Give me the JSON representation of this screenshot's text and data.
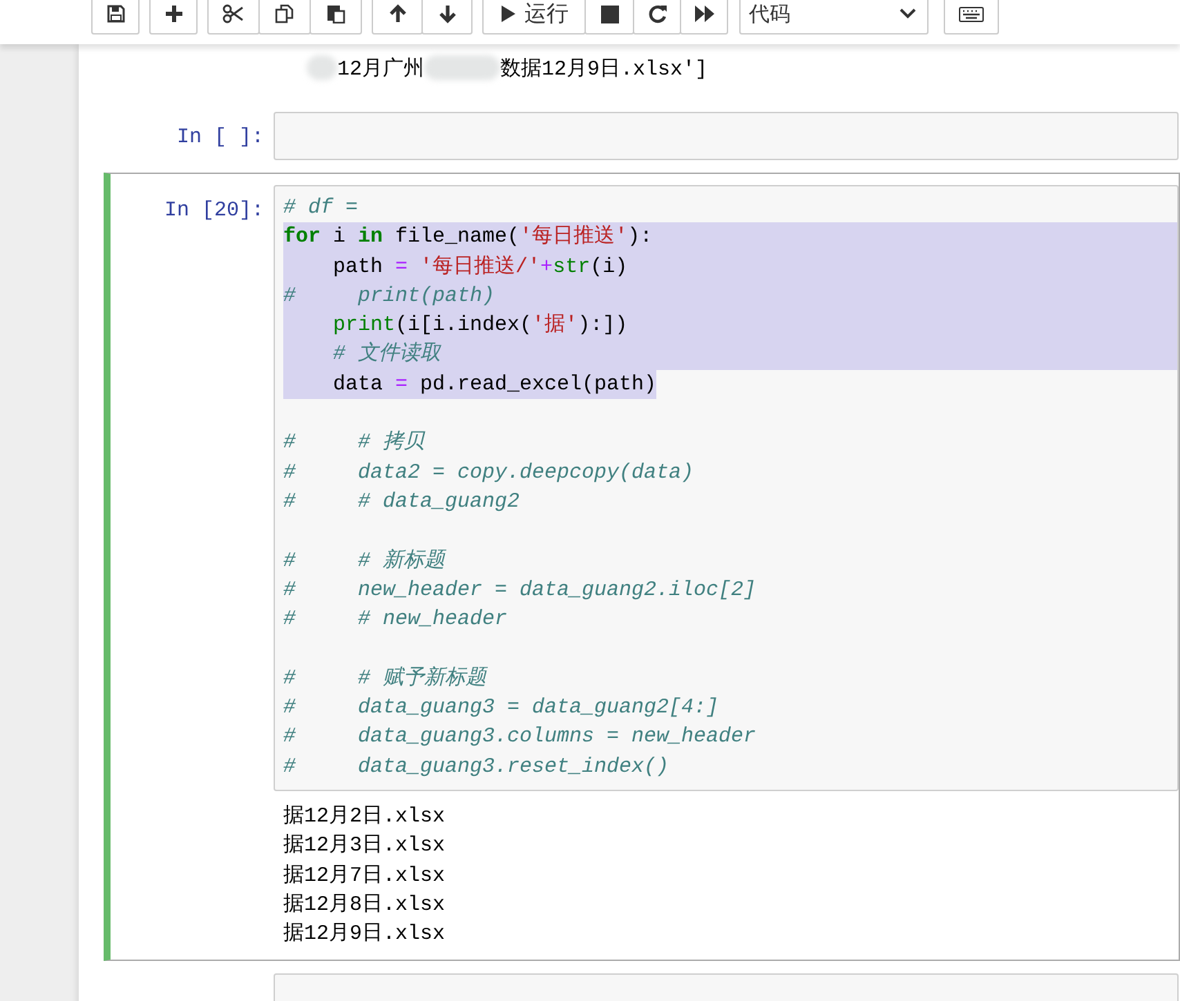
{
  "toolbar": {
    "run_label": "运行",
    "cell_type": "代码"
  },
  "previous_output": {
    "fragments": [
      "12月广州",
      "数据12月9日.xlsx']"
    ]
  },
  "cells": [
    {
      "prompt": "In [ ]:",
      "selected": false
    },
    {
      "prompt": "In [20]:",
      "selected": true,
      "code": [
        {
          "kind": "code",
          "selected": false,
          "tokens": [
            {
              "kind": "comment",
              "text": "# df ="
            }
          ]
        },
        {
          "kind": "code",
          "selected": true,
          "tokens": [
            {
              "kind": "keyword",
              "text": "for"
            },
            {
              "kind": "plain",
              "text": " i "
            },
            {
              "kind": "keyword",
              "text": "in"
            },
            {
              "kind": "plain",
              "text": " file_name("
            },
            {
              "kind": "string",
              "text": "'每日推送'"
            },
            {
              "kind": "plain",
              "text": "):"
            }
          ]
        },
        {
          "kind": "code",
          "selected": true,
          "tokens": [
            {
              "kind": "plain",
              "text": "    path "
            },
            {
              "kind": "operator",
              "text": "= "
            },
            {
              "kind": "string",
              "text": "'每日推送/'"
            },
            {
              "kind": "operator",
              "text": "+"
            },
            {
              "kind": "builtin",
              "text": "str"
            },
            {
              "kind": "plain",
              "text": "(i)"
            }
          ]
        },
        {
          "kind": "code",
          "selected": true,
          "tokens": [
            {
              "kind": "comment",
              "text": "#     print(path)"
            }
          ]
        },
        {
          "kind": "code",
          "selected": true,
          "tokens": [
            {
              "kind": "builtin",
              "text": "    print"
            },
            {
              "kind": "plain",
              "text": "(i[i.index("
            },
            {
              "kind": "string",
              "text": "'据'"
            },
            {
              "kind": "plain",
              "text": "):])"
            }
          ]
        },
        {
          "kind": "code",
          "selected": true,
          "tokens": [
            {
              "kind": "comment",
              "text": "    # 文件读取"
            }
          ]
        },
        {
          "kind": "code",
          "selected": true,
          "tokens": [
            {
              "kind": "plain",
              "text": "    data "
            },
            {
              "kind": "operator",
              "text": "="
            },
            {
              "kind": "plain",
              "text": " pd.read_excel(path)"
            }
          ]
        },
        {
          "kind": "blank"
        },
        {
          "kind": "code",
          "selected": false,
          "tokens": [
            {
              "kind": "comment",
              "text": "#     # 拷贝"
            }
          ]
        },
        {
          "kind": "code",
          "selected": false,
          "tokens": [
            {
              "kind": "comment",
              "text": "#     data2 = copy.deepcopy(data)"
            }
          ]
        },
        {
          "kind": "code",
          "selected": false,
          "tokens": [
            {
              "kind": "comment",
              "text": "#     # data_guang2"
            }
          ]
        },
        {
          "kind": "blank"
        },
        {
          "kind": "code",
          "selected": false,
          "tokens": [
            {
              "kind": "comment",
              "text": "#     # 新标题"
            }
          ]
        },
        {
          "kind": "code",
          "selected": false,
          "tokens": [
            {
              "kind": "comment",
              "text": "#     new_header = data_guang2.iloc[2]"
            }
          ]
        },
        {
          "kind": "code",
          "selected": false,
          "tokens": [
            {
              "kind": "comment",
              "text": "#     # new_header"
            }
          ]
        },
        {
          "kind": "blank"
        },
        {
          "kind": "code",
          "selected": false,
          "tokens": [
            {
              "kind": "comment",
              "text": "#     # 赋予新标题"
            }
          ]
        },
        {
          "kind": "code",
          "selected": false,
          "tokens": [
            {
              "kind": "comment",
              "text": "#     data_guang3 = data_guang2[4:]"
            }
          ]
        },
        {
          "kind": "code",
          "selected": false,
          "tokens": [
            {
              "kind": "comment",
              "text": "#     data_guang3.columns = new_header"
            }
          ]
        },
        {
          "kind": "code",
          "selected": false,
          "tokens": [
            {
              "kind": "comment",
              "text": "#     data_guang3.reset_index()"
            }
          ]
        }
      ],
      "output": [
        "据12月2日.xlsx",
        "据12月3日.xlsx",
        "据12月7日.xlsx",
        "据12月8日.xlsx",
        "据12月9日.xlsx"
      ]
    },
    {
      "selected": false
    }
  ]
}
